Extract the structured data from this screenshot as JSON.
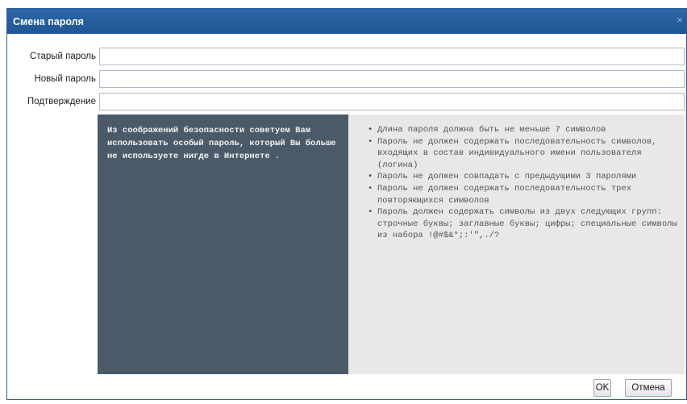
{
  "dialog": {
    "title": "Смена пароля",
    "close_glyph": "×"
  },
  "form": {
    "old_password_label": "Старый пароль",
    "new_password_label": "Новый пароль",
    "confirm_label": "Подтверждение",
    "old_password_value": "",
    "new_password_value": "",
    "confirm_value": ""
  },
  "advice": {
    "text": "Из соображений безопасности советуем Вам использовать особый пароль, который Вы больше не используете нигде в Интернете ."
  },
  "rules": [
    "Длина пароля должна быть не меньше 7 символов",
    "Пароль не должен содержать последовательность символов, входящих в состав индивидуального имени пользователя (логина)",
    "Пароль не должен совпадать с предыдущими 3 паролями",
    "Пароль не должен содержать последовательность трех повторяющихся символов",
    "Пароль должен содержать символы из двух следующих групп: строчные буквы; заглавные буквы; цифры; специальные символы из набора !@#$&*;:'\",./?"
  ],
  "buttons": {
    "ok": "OK",
    "cancel": "Отмена"
  }
}
